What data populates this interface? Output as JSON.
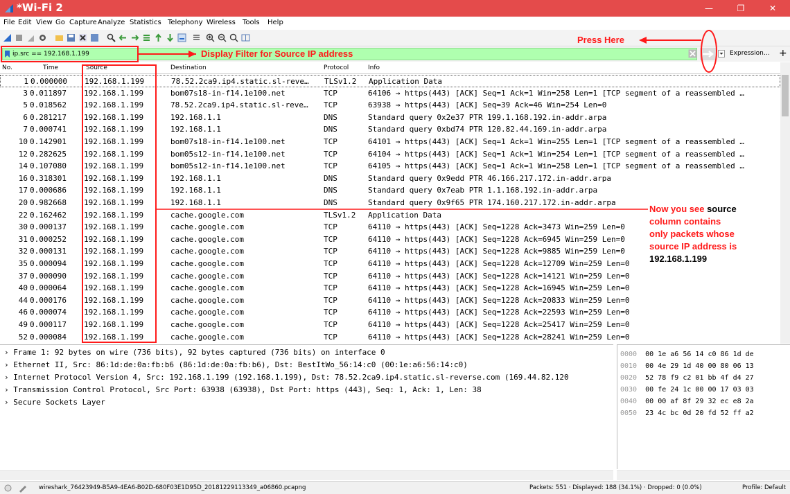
{
  "window": {
    "title": "*Wi-Fi 2",
    "controls": [
      "—",
      "❐",
      "✕"
    ]
  },
  "menu": [
    "File",
    "Edit",
    "View",
    "Go",
    "Capture",
    "Analyze",
    "Statistics",
    "Telephony",
    "Wireless",
    "Tools",
    "Help"
  ],
  "toolbar_icons": [
    "shark-fin-start-icon",
    "stop-icon",
    "restart-icon",
    "options-gear-icon",
    "open-folder-icon",
    "save-icon",
    "close-file-icon",
    "reload-icon",
    "find-icon",
    "back-icon",
    "forward-icon",
    "go-to-packet-icon",
    "first-packet-icon",
    "last-packet-icon",
    "autoscroll-icon",
    "colorize-icon",
    "zoom-in-icon",
    "zoom-out-icon",
    "normal-size-icon",
    "resize-columns-icon"
  ],
  "filter": {
    "value": "ip.src == 192.168.1.199",
    "expression_label": "Expression…",
    "plus": "+",
    "bg": "#afffaf"
  },
  "columns": {
    "no": "No.",
    "time": "Time",
    "source": "Source",
    "destination": "Destination",
    "protocol": "Protocol",
    "info": "Info"
  },
  "packets": [
    {
      "no": "1",
      "time": "0.000000",
      "src": "192.168.1.199",
      "dst": "78.52.2ca9.ip4.static.sl-reve…",
      "proto": "TLSv1.2",
      "info": "Application Data"
    },
    {
      "no": "3",
      "time": "0.011897",
      "src": "192.168.1.199",
      "dst": "bom07s18-in-f14.1e100.net",
      "proto": "TCP",
      "info": "64106 → https(443) [ACK] Seq=1 Ack=1 Win=258 Len=1 [TCP segment of a reassembled …"
    },
    {
      "no": "5",
      "time": "0.018562",
      "src": "192.168.1.199",
      "dst": "78.52.2ca9.ip4.static.sl-reve…",
      "proto": "TCP",
      "info": "63938 → https(443) [ACK] Seq=39 Ack=46 Win=254 Len=0"
    },
    {
      "no": "6",
      "time": "0.281217",
      "src": "192.168.1.199",
      "dst": "192.168.1.1",
      "proto": "DNS",
      "info": "Standard query 0x2e37 PTR 199.1.168.192.in-addr.arpa"
    },
    {
      "no": "7",
      "time": "0.000741",
      "src": "192.168.1.199",
      "dst": "192.168.1.1",
      "proto": "DNS",
      "info": "Standard query 0xbd74 PTR 120.82.44.169.in-addr.arpa"
    },
    {
      "no": "10",
      "time": "0.142901",
      "src": "192.168.1.199",
      "dst": "bom07s18-in-f14.1e100.net",
      "proto": "TCP",
      "info": "64101 → https(443) [ACK] Seq=1 Ack=1 Win=255 Len=1 [TCP segment of a reassembled …"
    },
    {
      "no": "12",
      "time": "0.282625",
      "src": "192.168.1.199",
      "dst": "bom05s12-in-f14.1e100.net",
      "proto": "TCP",
      "info": "64104 → https(443) [ACK] Seq=1 Ack=1 Win=254 Len=1 [TCP segment of a reassembled …"
    },
    {
      "no": "14",
      "time": "0.107080",
      "src": "192.168.1.199",
      "dst": "bom05s12-in-f14.1e100.net",
      "proto": "TCP",
      "info": "64105 → https(443) [ACK] Seq=1 Ack=1 Win=258 Len=1 [TCP segment of a reassembled …"
    },
    {
      "no": "16",
      "time": "0.318301",
      "src": "192.168.1.199",
      "dst": "192.168.1.1",
      "proto": "DNS",
      "info": "Standard query 0x9edd PTR 46.166.217.172.in-addr.arpa"
    },
    {
      "no": "17",
      "time": "0.000686",
      "src": "192.168.1.199",
      "dst": "192.168.1.1",
      "proto": "DNS",
      "info": "Standard query 0x7eab PTR 1.1.168.192.in-addr.arpa"
    },
    {
      "no": "20",
      "time": "0.982668",
      "src": "192.168.1.199",
      "dst": "192.168.1.1",
      "proto": "DNS",
      "info": "Standard query 0x9f65 PTR 174.160.217.172.in-addr.arpa"
    },
    {
      "no": "22",
      "time": "0.162462",
      "src": "192.168.1.199",
      "dst": "cache.google.com",
      "proto": "TLSv1.2",
      "info": "Application Data"
    },
    {
      "no": "30",
      "time": "0.000137",
      "src": "192.168.1.199",
      "dst": "cache.google.com",
      "proto": "TCP",
      "info": "64110 → https(443) [ACK] Seq=1228 Ack=3473 Win=259 Len=0"
    },
    {
      "no": "31",
      "time": "0.000252",
      "src": "192.168.1.199",
      "dst": "cache.google.com",
      "proto": "TCP",
      "info": "64110 → https(443) [ACK] Seq=1228 Ack=6945 Win=259 Len=0"
    },
    {
      "no": "32",
      "time": "0.000131",
      "src": "192.168.1.199",
      "dst": "cache.google.com",
      "proto": "TCP",
      "info": "64110 → https(443) [ACK] Seq=1228 Ack=9885 Win=259 Len=0"
    },
    {
      "no": "35",
      "time": "0.000094",
      "src": "192.168.1.199",
      "dst": "cache.google.com",
      "proto": "TCP",
      "info": "64110 → https(443) [ACK] Seq=1228 Ack=12709 Win=259 Len=0"
    },
    {
      "no": "37",
      "time": "0.000090",
      "src": "192.168.1.199",
      "dst": "cache.google.com",
      "proto": "TCP",
      "info": "64110 → https(443) [ACK] Seq=1228 Ack=14121 Win=259 Len=0"
    },
    {
      "no": "40",
      "time": "0.000064",
      "src": "192.168.1.199",
      "dst": "cache.google.com",
      "proto": "TCP",
      "info": "64110 → https(443) [ACK] Seq=1228 Ack=16945 Win=259 Len=0"
    },
    {
      "no": "44",
      "time": "0.000176",
      "src": "192.168.1.199",
      "dst": "cache.google.com",
      "proto": "TCP",
      "info": "64110 → https(443) [ACK] Seq=1228 Ack=20833 Win=259 Len=0"
    },
    {
      "no": "46",
      "time": "0.000074",
      "src": "192.168.1.199",
      "dst": "cache.google.com",
      "proto": "TCP",
      "info": "64110 → https(443) [ACK] Seq=1228 Ack=22593 Win=259 Len=0"
    },
    {
      "no": "49",
      "time": "0.000117",
      "src": "192.168.1.199",
      "dst": "cache.google.com",
      "proto": "TCP",
      "info": "64110 → https(443) [ACK] Seq=1228 Ack=25417 Win=259 Len=0"
    },
    {
      "no": "52",
      "time": "0.000084",
      "src": "192.168.1.199",
      "dst": "cache.google.com",
      "proto": "TCP",
      "info": "64110 → https(443) [ACK] Seq=1228 Ack=28241 Win=259 Len=0"
    }
  ],
  "details": [
    "Frame 1: 92 bytes on wire (736 bits), 92 bytes captured (736 bits) on interface 0",
    "Ethernet II, Src: 86:1d:de:0a:fb:b6 (86:1d:de:0a:fb:b6), Dst: BestItWo_56:14:c0 (00:1e:a6:56:14:c0)",
    "Internet Protocol Version 4, Src: 192.168.1.199 (192.168.1.199), Dst: 78.52.2ca9.ip4.static.sl-reverse.com (169.44.82.120",
    "Transmission Control Protocol, Src Port: 63938 (63938), Dst Port: https (443), Seq: 1, Ack: 1, Len: 38",
    "Secure Sockets Layer"
  ],
  "hex": [
    {
      "off": "0000",
      "bytes": "00 1e a6 56 14 c0 86 1d  de"
    },
    {
      "off": "0010",
      "bytes": "00 4e 29 1d 40 00 80 06  13"
    },
    {
      "off": "0020",
      "bytes": "52 78 f9 c2 01 bb 4f d4  27"
    },
    {
      "off": "0030",
      "bytes": "00 fe 24 1c 00 00 17 03  03"
    },
    {
      "off": "0040",
      "bytes": "00 00 af 8f 29 32 ec e8  2a"
    },
    {
      "off": "0050",
      "bytes": "23 4c bc 0d 20 fd 52 ff  a2"
    }
  ],
  "status": {
    "file": "wireshark_76423949-B5A9-4EA6-B02D-680F03E1D95D_20181229113349_a06860.pcapng",
    "packets": "Packets: 551 · Displayed: 188 (34.1%) · Dropped: 0 (0.0%)",
    "profile": "Profile: Default"
  },
  "annotations": {
    "filter_label": "Display Filter for Source IP address",
    "press_here": "Press Here",
    "note_line1": "Now you see ",
    "note_line1b": "source",
    "note_line2": "column contains",
    "note_line3": "only packets whose",
    "note_line4": "source IP address is",
    "note_ip": "192.168.1.199",
    "color": "#ff1a1a"
  },
  "colors": {
    "titlebar": "#e44b4b",
    "filter_green": "#afffaf",
    "annotation_red": "#ff1a1a"
  }
}
